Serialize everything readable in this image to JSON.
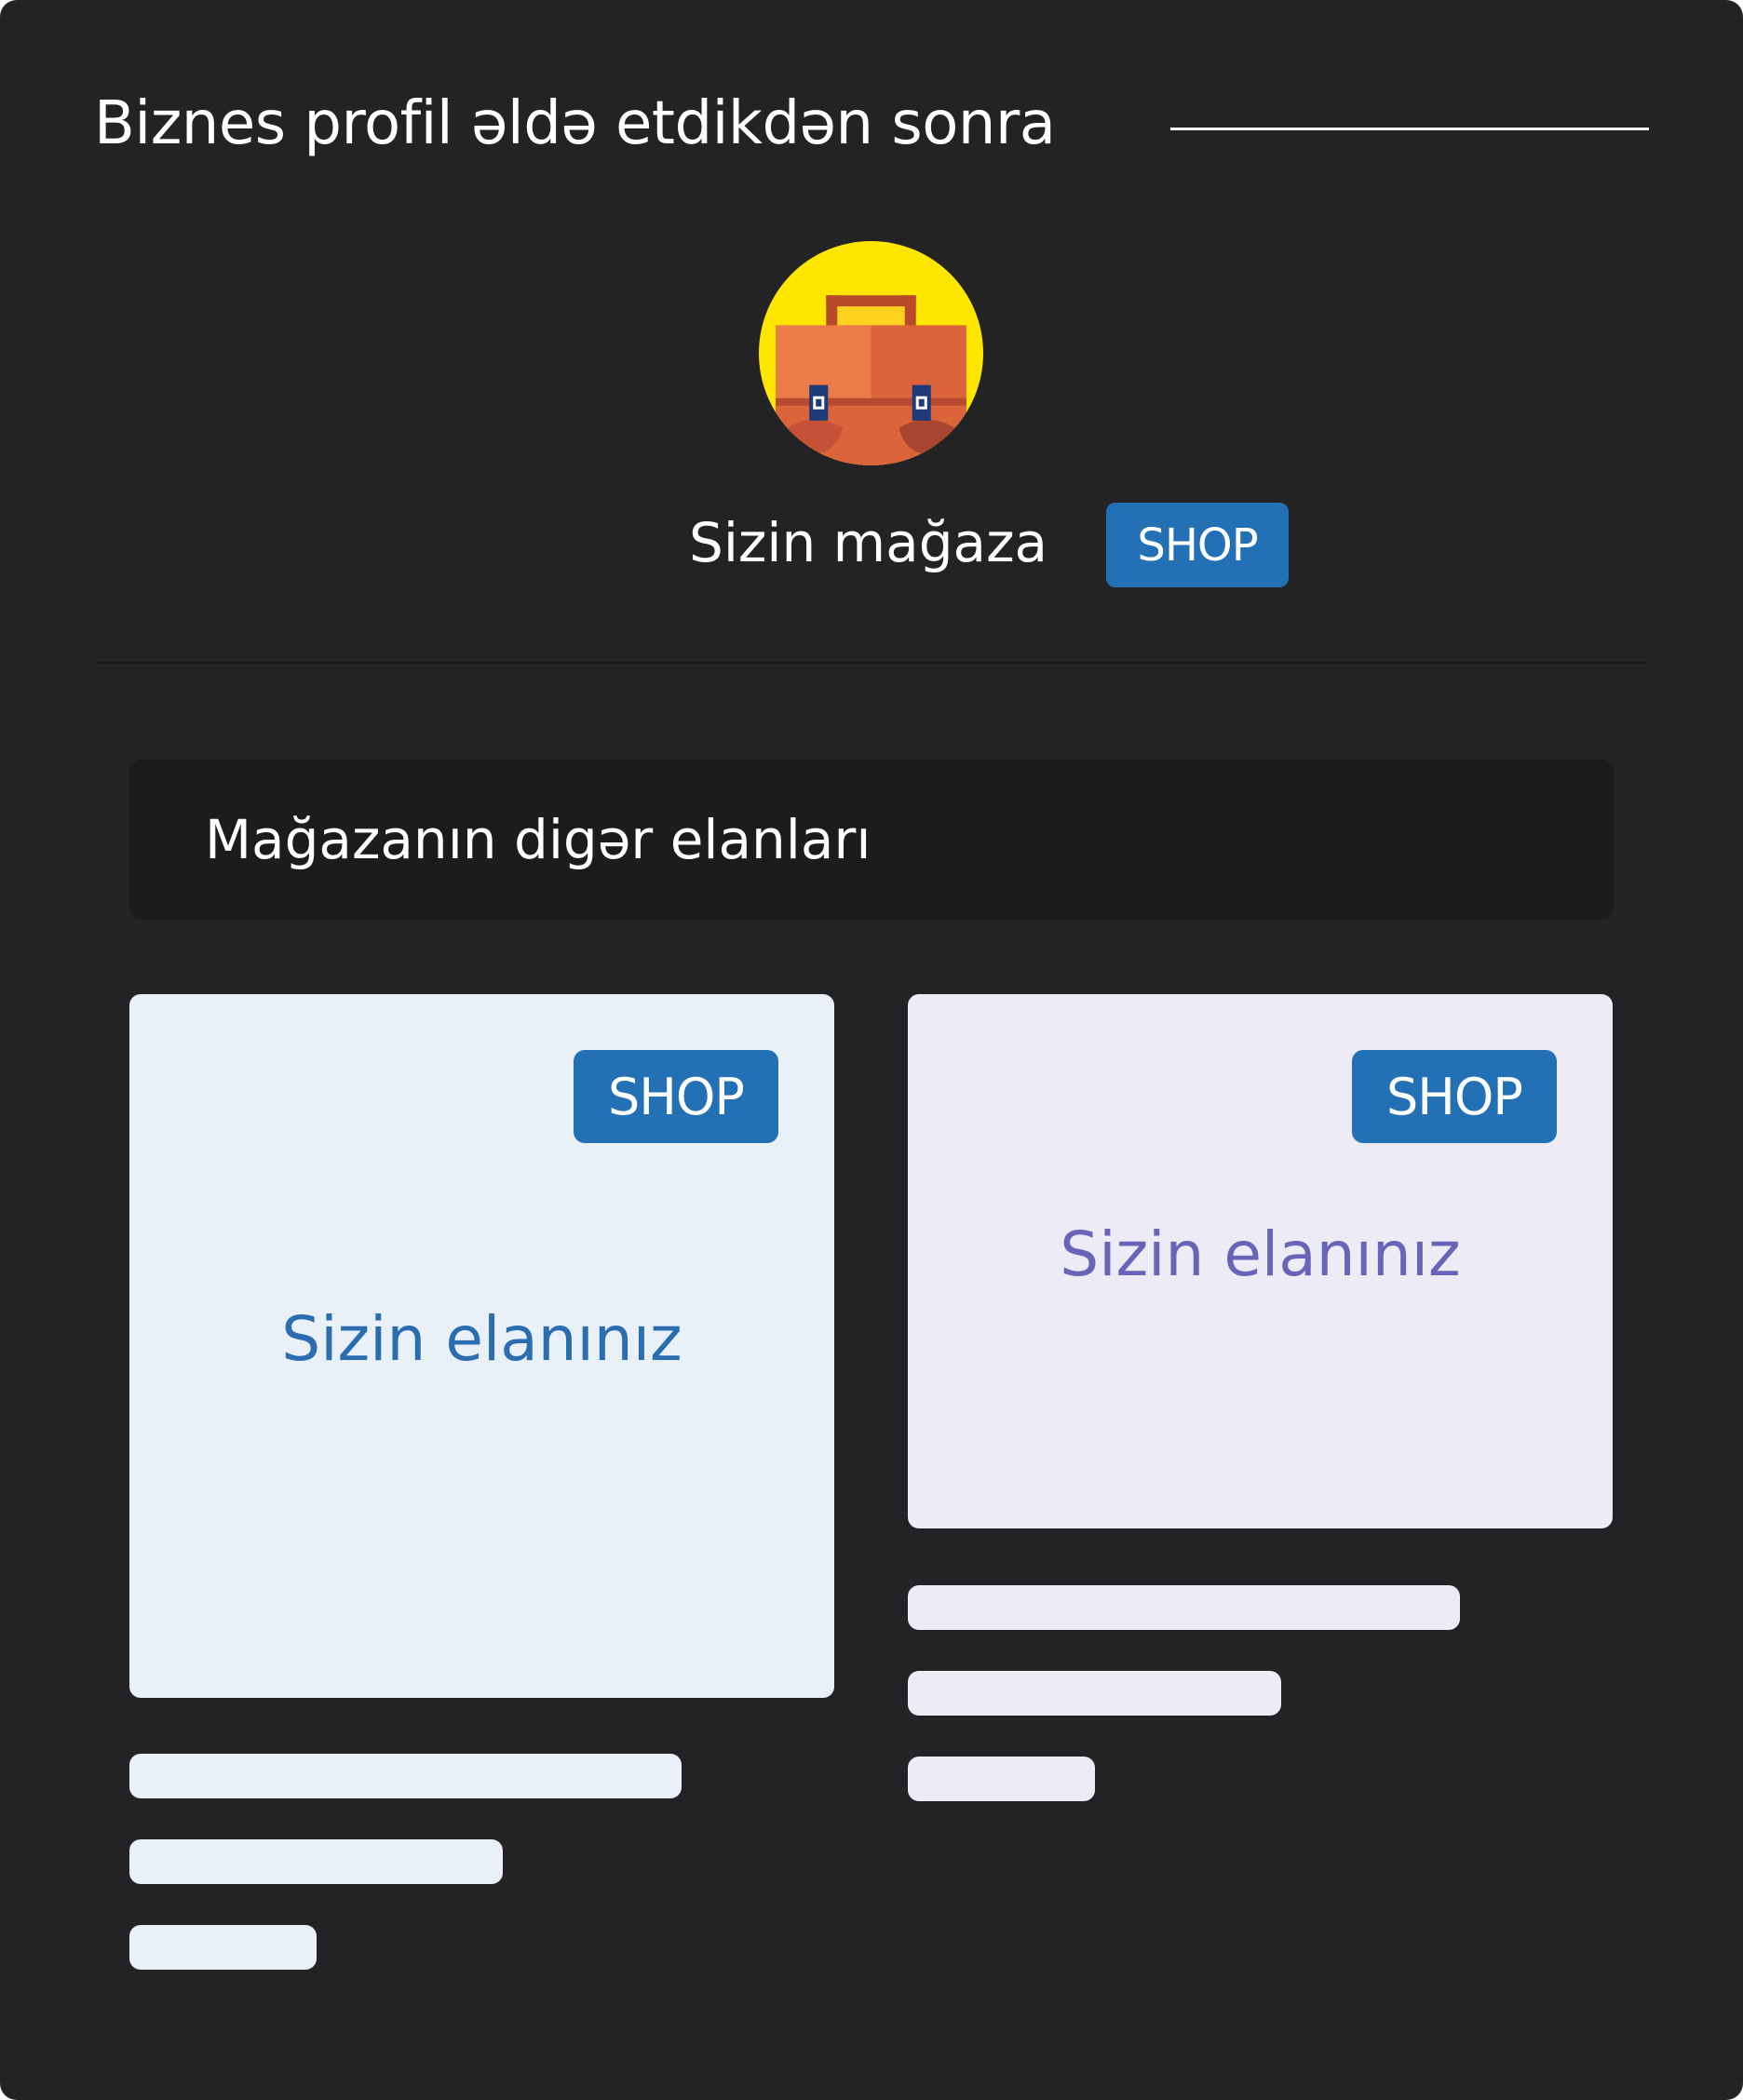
{
  "header": {
    "title": "Biznes profil əldə etdikdən sonra"
  },
  "profile": {
    "avatar_icon": "briefcase-icon",
    "name": "Sizin mağaza",
    "badge": "SHOP"
  },
  "section": {
    "title": "Mağazanın digər elanları"
  },
  "listings": [
    {
      "badge": "SHOP",
      "text": "Sizin elanınız"
    },
    {
      "badge": "SHOP",
      "text": "Sizin elanınız"
    }
  ],
  "colors": {
    "panel_bg": "#232325",
    "badge_bg": "#2370b5",
    "card_left_bg": "#eaf0f8",
    "card_right_bg": "#ecebf6",
    "card_left_text": "#2a6db0",
    "card_right_text": "#6865b8",
    "avatar_bg": "#ffe600"
  }
}
